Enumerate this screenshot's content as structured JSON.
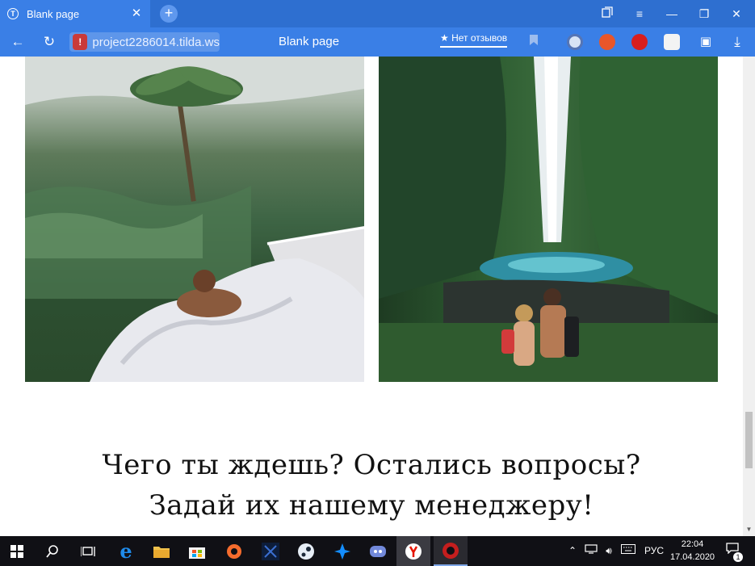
{
  "browser": {
    "tab_title": "Blank page",
    "tab_favicon_glyph": "T",
    "url": "project2286014.tilda.ws",
    "page_title": "Blank page",
    "reviews_label": "★ Нет отзывов",
    "accent_color": "#3a7fe6"
  },
  "content": {
    "heading_line1": "Чего ты ждешь? Остались вопросы?",
    "heading_line2": "Задай их нашему менеджеру!",
    "images": [
      "tropical-resort-photo",
      "waterfall-couple-photo"
    ]
  },
  "taskbar": {
    "language": "РУС",
    "time": "22:04",
    "date": "17.04.2020",
    "notification_count": "1"
  }
}
